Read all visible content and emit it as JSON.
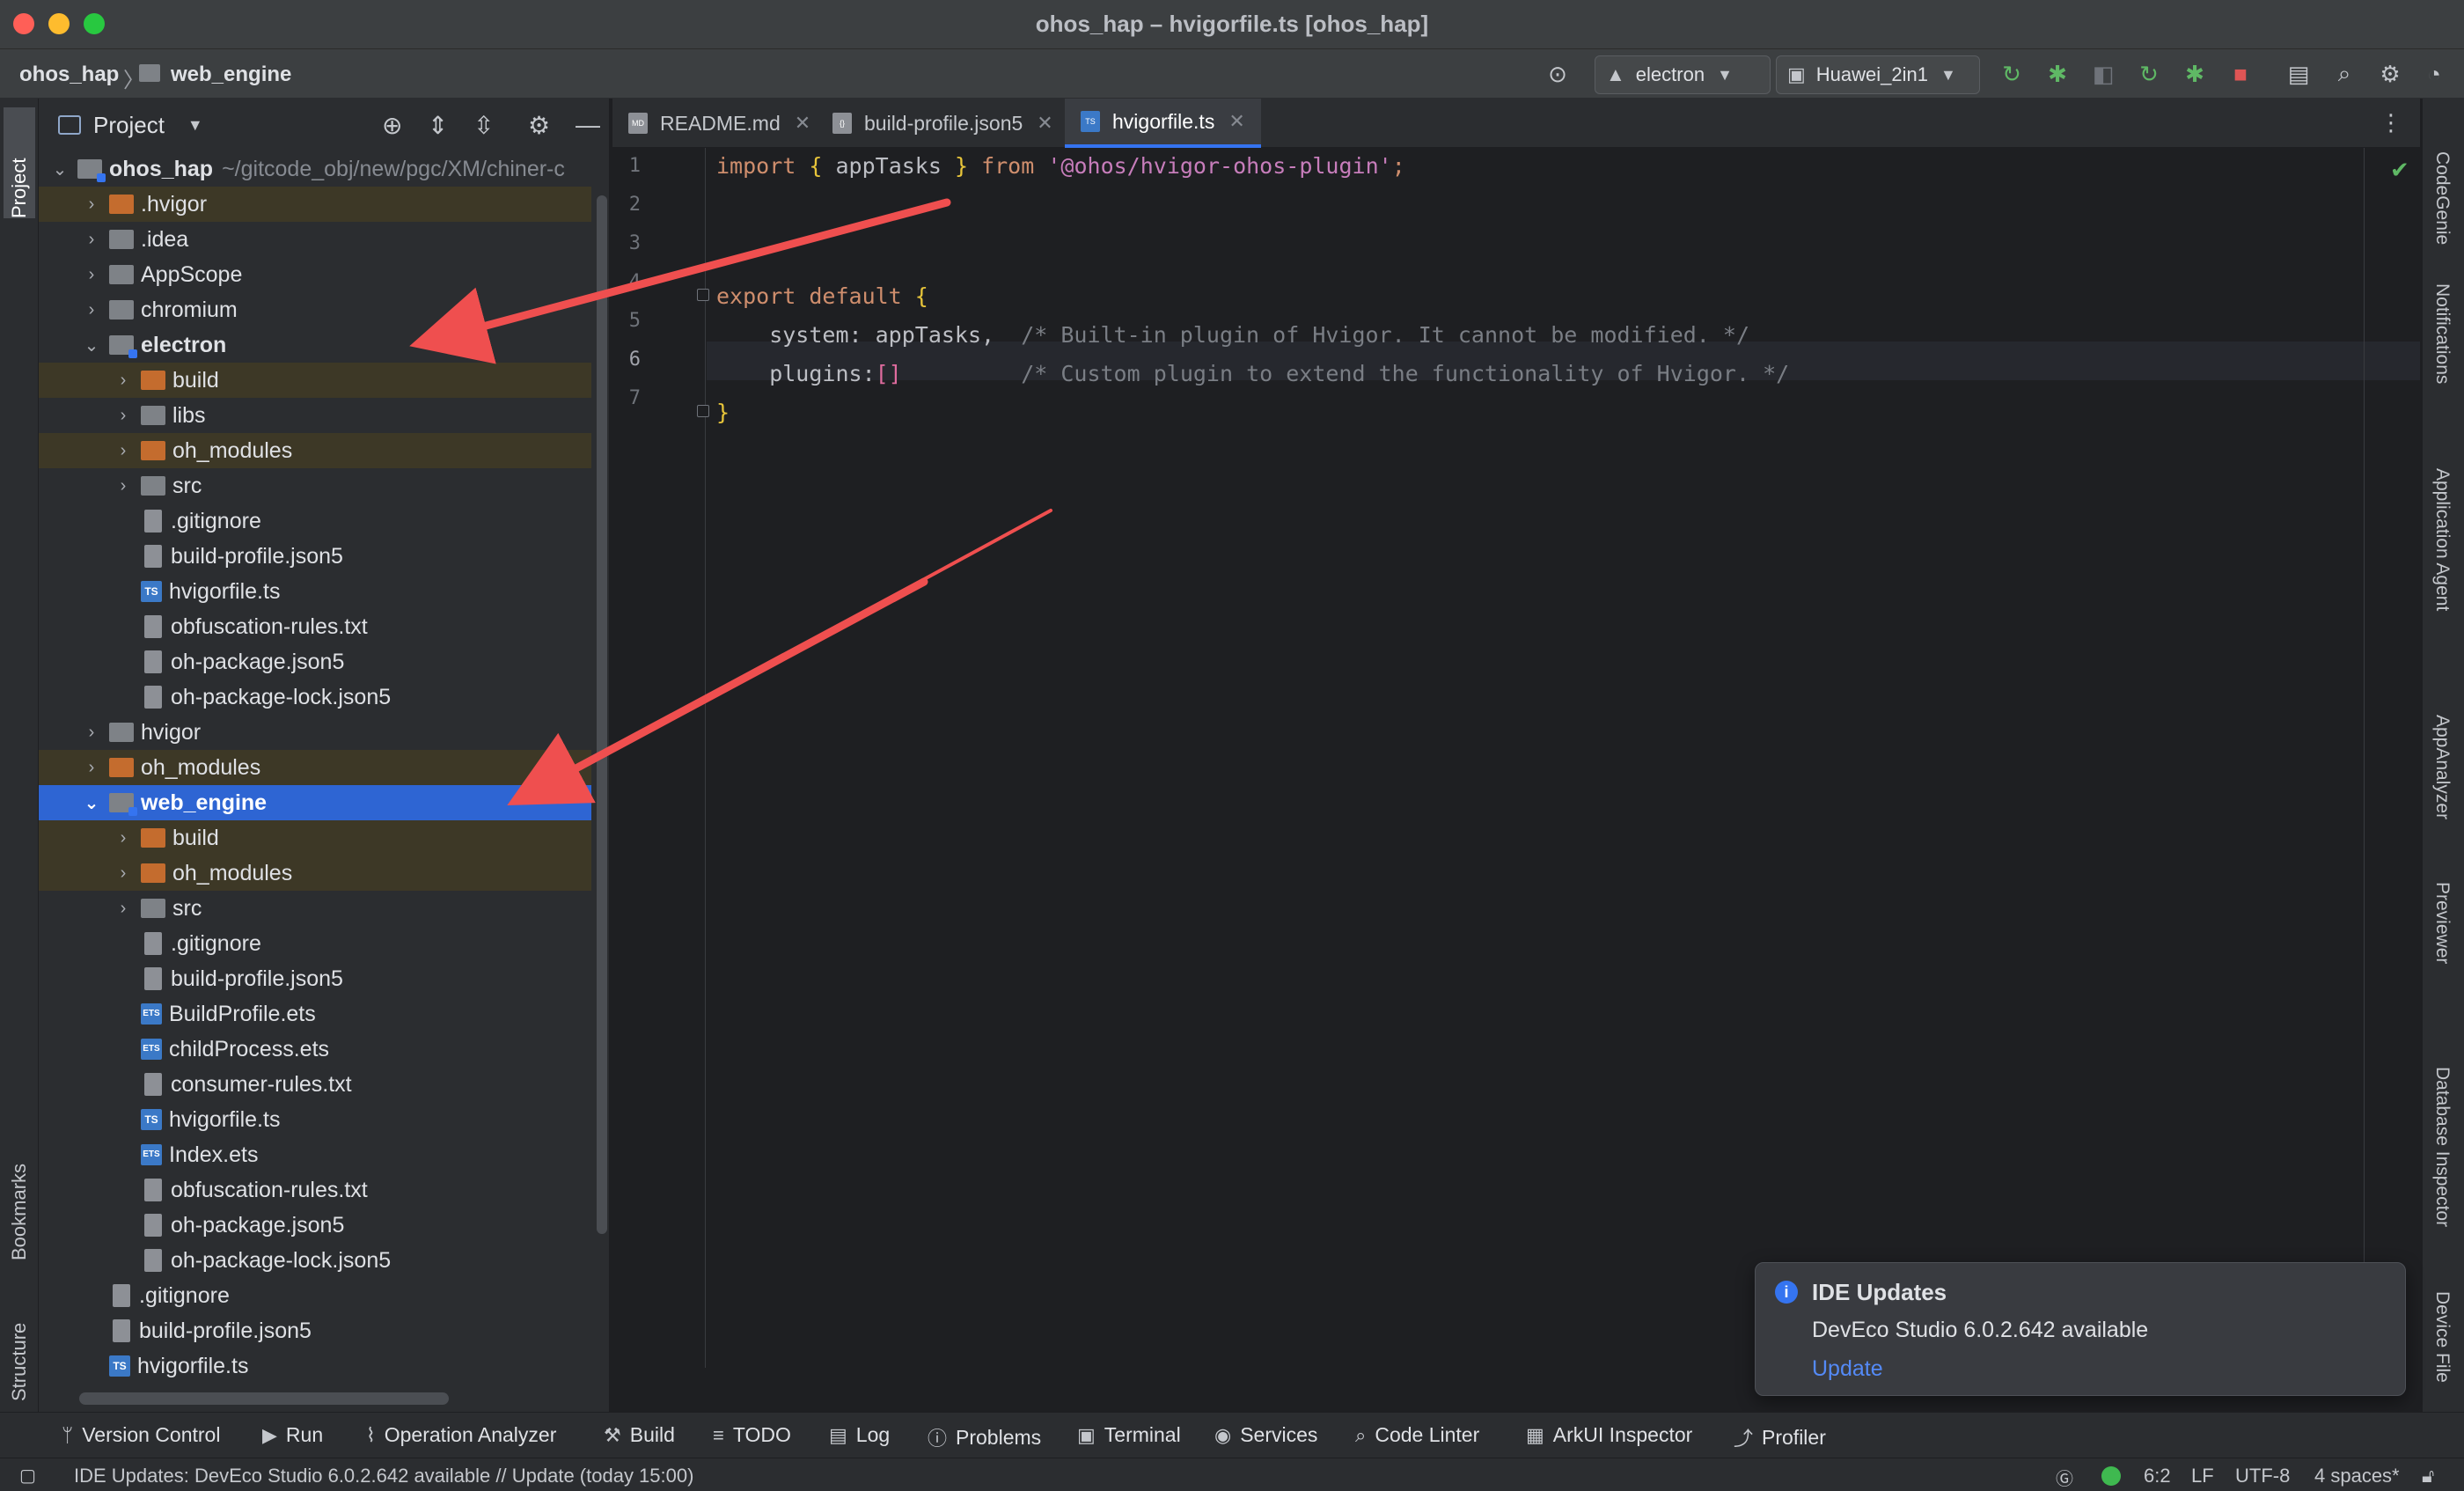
{
  "window": {
    "title": "ohos_hap – hvigorfile.ts [ohos_hap]"
  },
  "nav": {
    "breadcrumb": [
      "ohos_hap",
      "web_engine"
    ],
    "module_selector": "electron",
    "device_selector": "Huawei_2in1"
  },
  "project_panel": {
    "title": "Project",
    "tree": [
      {
        "label": "ohos_hap",
        "path": "~/gitcode_obj/new/pgc/XM/chiner-c",
        "depth": 0,
        "kind": "module",
        "chevron": "down",
        "bold": true
      },
      {
        "label": ".hvigor",
        "depth": 1,
        "kind": "excluded",
        "chevron": "right"
      },
      {
        "label": ".idea",
        "depth": 1,
        "kind": "dir",
        "chevron": "right"
      },
      {
        "label": "AppScope",
        "depth": 1,
        "kind": "dir",
        "chevron": "right"
      },
      {
        "label": "chromium",
        "depth": 1,
        "kind": "dir",
        "chevron": "right"
      },
      {
        "label": "electron",
        "depth": 1,
        "kind": "module",
        "chevron": "down",
        "bold": true
      },
      {
        "label": "build",
        "depth": 2,
        "kind": "excluded",
        "chevron": "right"
      },
      {
        "label": "libs",
        "depth": 2,
        "kind": "dir",
        "chevron": "right"
      },
      {
        "label": "oh_modules",
        "depth": 2,
        "kind": "excluded",
        "chevron": "right"
      },
      {
        "label": "src",
        "depth": 2,
        "kind": "dir",
        "chevron": "right"
      },
      {
        "label": ".gitignore",
        "depth": 2,
        "kind": "file"
      },
      {
        "label": "build-profile.json5",
        "depth": 2,
        "kind": "file"
      },
      {
        "label": "hvigorfile.ts",
        "depth": 2,
        "kind": "ts"
      },
      {
        "label": "obfuscation-rules.txt",
        "depth": 2,
        "kind": "file"
      },
      {
        "label": "oh-package.json5",
        "depth": 2,
        "kind": "file"
      },
      {
        "label": "oh-package-lock.json5",
        "depth": 2,
        "kind": "file"
      },
      {
        "label": "hvigor",
        "depth": 1,
        "kind": "dir",
        "chevron": "right"
      },
      {
        "label": "oh_modules",
        "depth": 1,
        "kind": "excluded",
        "chevron": "right"
      },
      {
        "label": "web_engine",
        "depth": 1,
        "kind": "module",
        "chevron": "down",
        "bold": true,
        "selected": true
      },
      {
        "label": "build",
        "depth": 2,
        "kind": "excluded",
        "chevron": "right"
      },
      {
        "label": "oh_modules",
        "depth": 2,
        "kind": "excluded",
        "chevron": "right"
      },
      {
        "label": "src",
        "depth": 2,
        "kind": "dir",
        "chevron": "right"
      },
      {
        "label": ".gitignore",
        "depth": 2,
        "kind": "file"
      },
      {
        "label": "build-profile.json5",
        "depth": 2,
        "kind": "file"
      },
      {
        "label": "BuildProfile.ets",
        "depth": 2,
        "kind": "ets"
      },
      {
        "label": "childProcess.ets",
        "depth": 2,
        "kind": "ets"
      },
      {
        "label": "consumer-rules.txt",
        "depth": 2,
        "kind": "file"
      },
      {
        "label": "hvigorfile.ts",
        "depth": 2,
        "kind": "ts"
      },
      {
        "label": "Index.ets",
        "depth": 2,
        "kind": "ets"
      },
      {
        "label": "obfuscation-rules.txt",
        "depth": 2,
        "kind": "file"
      },
      {
        "label": "oh-package.json5",
        "depth": 2,
        "kind": "file"
      },
      {
        "label": "oh-package-lock.json5",
        "depth": 2,
        "kind": "file"
      },
      {
        "label": ".gitignore",
        "depth": 1,
        "kind": "file"
      },
      {
        "label": "build-profile.json5",
        "depth": 1,
        "kind": "file"
      },
      {
        "label": "hvigorfile.ts",
        "depth": 1,
        "kind": "ts"
      }
    ]
  },
  "left_strip": {
    "project": "Project",
    "bookmarks": "Bookmarks",
    "structure": "Structure"
  },
  "tabs": [
    {
      "label": "README.md",
      "icon": "MD",
      "active": false
    },
    {
      "label": "build-profile.json5",
      "icon": "{}",
      "active": false
    },
    {
      "label": "hvigorfile.ts",
      "icon": "TS",
      "active": true
    }
  ],
  "editor": {
    "line_numbers": [
      "1",
      "2",
      "3",
      "4",
      "5",
      "6",
      "7"
    ],
    "lines": {
      "l1_import": "import",
      "l1_open": "{",
      "l1_name": " appTasks ",
      "l1_close": "}",
      "l1_from": "from",
      "l1_str": "'@ohos/hvigor-ohos-plugin'",
      "l1_semi": ";",
      "l3_export": "export default",
      "l3_brace": "{",
      "l4_key": "    system: appTasks,",
      "l4_comment": "/* Built-in plugin of Hvigor. It cannot be modified. */",
      "l5_key": "    plugins:",
      "l5_arr": "[]",
      "l5_comment": "/* Custom plugin to extend the functionality of Hvigor. */",
      "l6_brace": "}"
    },
    "cursor_line": 6
  },
  "right_strip": [
    "CodeGenie",
    "Notifications",
    "Application Agent",
    "AppAnalyzer",
    "Previewer",
    "Database Inspector",
    "Device File"
  ],
  "notification": {
    "title": "IDE Updates",
    "body": "DevEco Studio 6.0.2.642 available",
    "link": "Update"
  },
  "bottom_tools": [
    "Version Control",
    "Run",
    "Operation Analyzer",
    "Build",
    "TODO",
    "Log",
    "Problems",
    "Terminal",
    "Services",
    "Code Linter",
    "ArkUI Inspector",
    "Profiler"
  ],
  "status": {
    "message": "IDE Updates: DevEco Studio 6.0.2.642 available // Update (today 15:00)",
    "position": "6:2",
    "line_sep": "LF",
    "encoding": "UTF-8",
    "indent": "4 spaces*"
  },
  "colors": {
    "accent": "#3574f0",
    "selection": "#2e65d3",
    "arrow": "#ef4f4f",
    "excluded_folder": "#c46c2e"
  }
}
